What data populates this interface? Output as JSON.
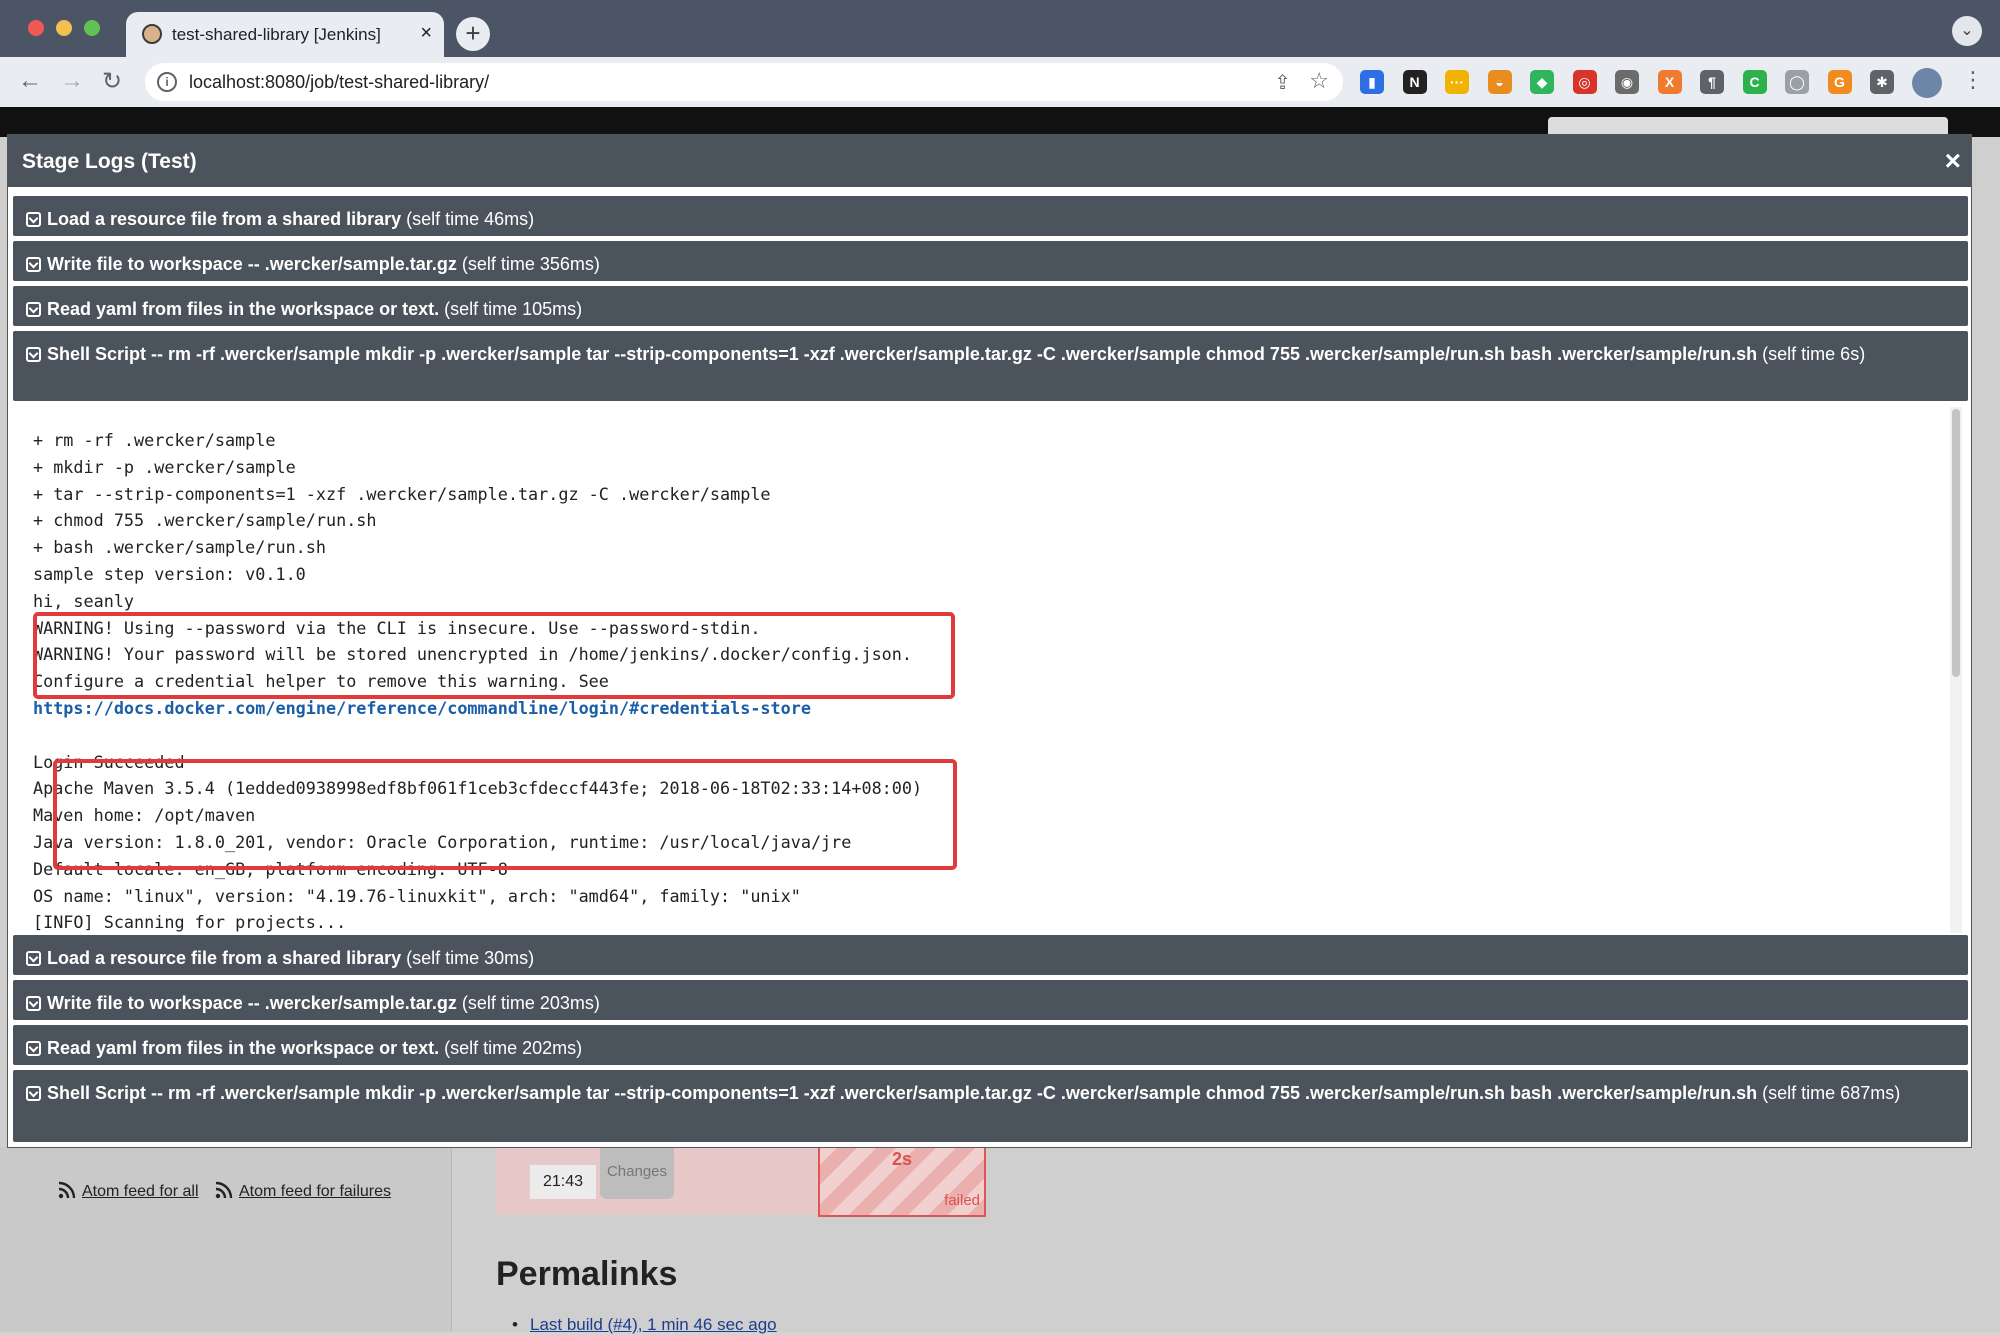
{
  "browser": {
    "tab_title": "test-shared-library [Jenkins]",
    "tab_close": "×",
    "new_tab": "+",
    "url": "localhost:8080/job/test-shared-library/",
    "extensions": [
      {
        "name": "bar-chart-extension-icon",
        "glyph": "▮",
        "color": "#2f6fe4"
      },
      {
        "name": "notion-extension-icon",
        "glyph": "N",
        "color": "#222222"
      },
      {
        "name": "dots-extension-icon",
        "glyph": "···",
        "color": "#f0b400"
      },
      {
        "name": "bowl-extension-icon",
        "glyph": "◒",
        "color": "#e98c1f"
      },
      {
        "name": "evernote-extension-icon",
        "glyph": "◆",
        "color": "#2fb55d"
      },
      {
        "name": "translate-extension-icon",
        "glyph": "◎",
        "color": "#d9342b"
      },
      {
        "name": "glasses-extension-icon",
        "glyph": "◉",
        "color": "#6b6b6b"
      },
      {
        "name": "xml-extension-icon",
        "glyph": "X",
        "color": "#f07a2f"
      },
      {
        "name": "pilcrow-extension-icon",
        "glyph": "¶",
        "color": "#5f6368"
      },
      {
        "name": "c-extension-icon",
        "glyph": "C",
        "color": "#2bb24c"
      },
      {
        "name": "search-badge-extension-icon",
        "glyph": "◯",
        "color": "#9aa0a6"
      },
      {
        "name": "g-extension-icon",
        "glyph": "G",
        "color": "#f08c1f"
      },
      {
        "name": "puzzle-extension-icon",
        "glyph": "✱",
        "color": "#5f6368"
      }
    ]
  },
  "modal": {
    "title": "Stage Logs (Test)",
    "close": "×",
    "steps_top": [
      {
        "name": "Load a resource file from a shared library",
        "time": " (self time 46ms)"
      },
      {
        "name": "Write file to workspace -- .wercker/sample.tar.gz",
        "time": " (self time 356ms)"
      },
      {
        "name": "Read yaml from files in the workspace or text.",
        "time": " (self time 105ms)"
      },
      {
        "name": "Shell Script -- rm -rf .wercker/sample mkdir -p .wercker/sample tar --strip-components=1 -xzf .wercker/sample.tar.gz -C .wercker/sample chmod 755 .wercker/sample/run.sh bash .wercker/sample/run.sh",
        "time": " (self time 6s)"
      }
    ],
    "log_lines_before_link": [
      "+ rm -rf .wercker/sample",
      "+ mkdir -p .wercker/sample",
      "+ tar --strip-components=1 -xzf .wercker/sample.tar.gz -C .wercker/sample",
      "+ chmod 755 .wercker/sample/run.sh",
      "+ bash .wercker/sample/run.sh",
      "sample step version: v0.1.0",
      "hi, seanly",
      "WARNING! Using --password via the CLI is insecure. Use --password-stdin.",
      "WARNING! Your password will be stored unencrypted in /home/jenkins/.docker/config.json.",
      "Configure a credential helper to remove this warning. See"
    ],
    "log_link": "https://docs.docker.com/engine/reference/commandline/login/#credentials-store",
    "log_lines_after_link": [
      "",
      "Login Succeeded",
      "Apache Maven 3.5.4 (1edded0938998edf8bf061f1ceb3cfdeccf443fe; 2018-06-18T02:33:14+08:00)",
      "Maven home: /opt/maven",
      "Java version: 1.8.0_201, vendor: Oracle Corporation, runtime: /usr/local/java/jre",
      "Default locale: en_GB, platform encoding: UTF-8",
      "OS name: \"linux\", version: \"4.19.76-linuxkit\", arch: \"amd64\", family: \"unix\"",
      "[INFO] Scanning for projects..."
    ],
    "steps_bottom": [
      {
        "name": "Load a resource file from a shared library",
        "time": " (self time 30ms)"
      },
      {
        "name": "Write file to workspace -- .wercker/sample.tar.gz",
        "time": " (self time 203ms)"
      },
      {
        "name": "Read yaml from files in the workspace or text.",
        "time": " (self time 202ms)"
      },
      {
        "name": "Shell Script -- rm -rf .wercker/sample mkdir -p .wercker/sample tar --strip-components=1 -xzf .wercker/sample.tar.gz -C .wercker/sample chmod 755 .wercker/sample/run.sh bash .wercker/sample/run.sh",
        "time": " (self time 687ms)"
      }
    ]
  },
  "page": {
    "atom_all": "Atom feed for all",
    "atom_failures": "Atom feed for failures",
    "build_time": "21:43",
    "changes": "Changes",
    "failed_duration": "2s",
    "failed_label": "failed",
    "permalinks_title": "Permalinks",
    "last_build": "Last build (#4), 1 min 46 sec ago"
  },
  "colors": {
    "modal_header": "#4b535c",
    "highlight": "#e23a3a",
    "link": "#1b5ea8"
  }
}
